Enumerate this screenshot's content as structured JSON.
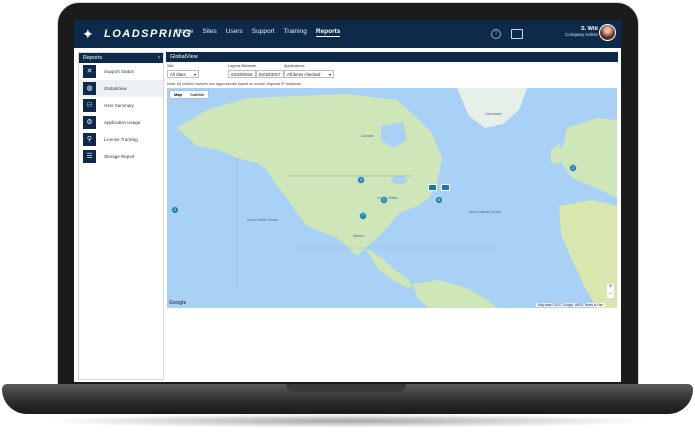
{
  "brand": {
    "name": "LOADSPRING",
    "icon": "runner-logo-icon"
  },
  "nav": {
    "items": [
      "Home",
      "Sites",
      "Users",
      "Support",
      "Training",
      "Reports"
    ],
    "active": "Reports"
  },
  "user": {
    "name": "S. Witt",
    "role": "Company Admin"
  },
  "sidebar": {
    "title": "Reports",
    "items": [
      {
        "label": "Support Status",
        "icon": "tools-icon"
      },
      {
        "label": "GlobalView",
        "icon": "globe-icon",
        "active": true
      },
      {
        "label": "User Summary",
        "icon": "users-icon"
      },
      {
        "label": "Application Usage",
        "icon": "gears-icon"
      },
      {
        "label": "License Tracking",
        "icon": "search-icon"
      },
      {
        "label": "Storage Report",
        "icon": "server-icon"
      }
    ]
  },
  "main": {
    "title": "GlobalView",
    "filters": {
      "site_label": "Site",
      "site_value": "All Sites",
      "logons_label": "Logons Between",
      "date_from": "04/18/2016",
      "date_to": "04/18/2017",
      "apps_label": "Applications",
      "apps_value": "All items checked"
    },
    "note": "Note: All plotted markers are approximate based on known regional IP locations."
  },
  "map": {
    "tabs": [
      "Map",
      "Satellite"
    ],
    "active_tab": "Map",
    "markers": [
      "2",
      "3",
      "6",
      "8",
      "7",
      "2",
      "2"
    ],
    "labels": {
      "north_pacific": "North Pacific Ocean",
      "north_atlantic": "North Atlantic Ocean",
      "united_states": "United States",
      "mexico": "Mexico",
      "greenland": "Greenland",
      "canada": "Canada"
    },
    "zoom_in": "+",
    "zoom_out": "−",
    "google": "Google",
    "attribution": "Map data ©2017 Google, INEGI   Terms of Use"
  },
  "colors": {
    "navy": "#0e2a4a",
    "water": "#a9d0f5",
    "land": "#cfe6b8",
    "marker": "#1f7ea1"
  }
}
